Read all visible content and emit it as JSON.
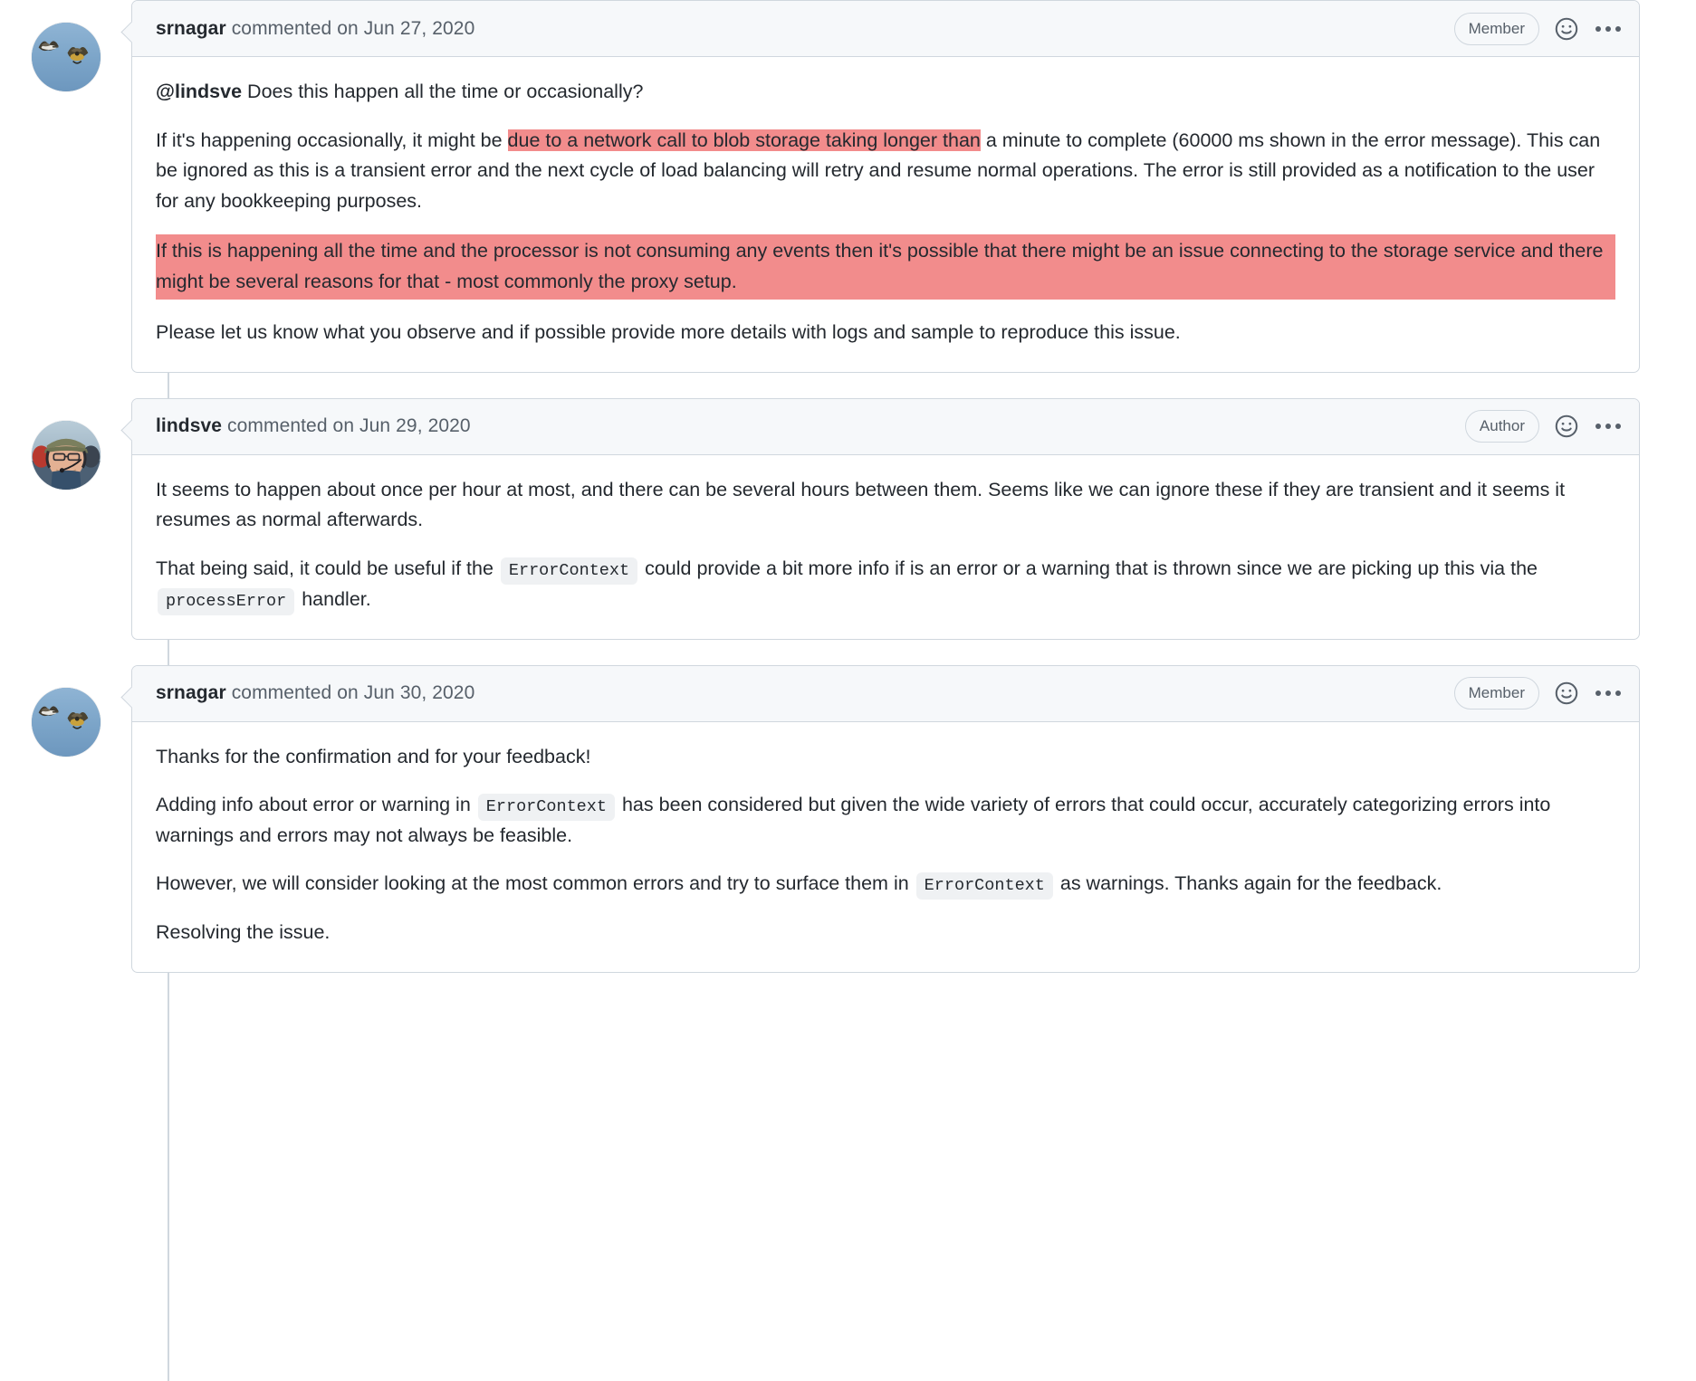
{
  "colors": {
    "highlight": "#f28c8c",
    "header_bg": "#f6f8fa",
    "border": "#d0d7de",
    "code_bg": "#eff1f3",
    "text": "#24292f",
    "muted_text": "#57606a"
  },
  "icons": {
    "reaction": "smiley-icon",
    "menu": "kebab-horizontal-icon"
  },
  "comments": [
    {
      "author": "srnagar",
      "meta": "commented on Jun 27, 2020",
      "badge": "Member",
      "avatar": "birds-flying-photo",
      "paragraphs": [
        {
          "id": "p1",
          "segments": [
            {
              "type": "mention",
              "text": "@lindsve"
            },
            {
              "type": "text",
              "text": " Does this happen all the time or occasionally?"
            }
          ]
        },
        {
          "id": "p2",
          "segments": [
            {
              "type": "text",
              "text": "If it's happening occasionally, it might be "
            },
            {
              "type": "highlight",
              "text": "due to a network call to blob storage taking longer than"
            },
            {
              "type": "text",
              "text": " a minute to complete (60000 ms shown in the error message). This can be ignored as this is a transient error and the next cycle of load balancing will retry and resume normal operations. The error is still provided as a notification to the user for any bookkeeping purposes."
            }
          ]
        },
        {
          "id": "p3",
          "block_highlight": true,
          "segments": [
            {
              "type": "text",
              "text": "If this is happening all the time and the processor is not consuming any events then it's possible that there might be an issue connecting to the storage service and there might be several reasons for that - most commonly the proxy setup."
            }
          ]
        },
        {
          "id": "p4",
          "segments": [
            {
              "type": "text",
              "text": "Please let us know what you observe and if possible provide more details with logs and sample to reproduce this issue."
            }
          ]
        }
      ]
    },
    {
      "author": "lindsve",
      "meta": "commented on Jun 29, 2020",
      "badge": "Author",
      "avatar": "pilot-headset-photo",
      "paragraphs": [
        {
          "id": "p1",
          "segments": [
            {
              "type": "text",
              "text": "It seems to happen about once per hour at most, and there can be several hours between them. Seems like we can ignore these if they are transient and it seems it resumes as normal afterwards."
            }
          ]
        },
        {
          "id": "p2",
          "segments": [
            {
              "type": "text",
              "text": "That being said, it could be useful if the "
            },
            {
              "type": "code",
              "text": "ErrorContext"
            },
            {
              "type": "text",
              "text": " could provide a bit more info if is an error or a warning that is thrown since we are picking up this via the "
            },
            {
              "type": "code",
              "text": "processError"
            },
            {
              "type": "text",
              "text": " handler."
            }
          ]
        }
      ]
    },
    {
      "author": "srnagar",
      "meta": "commented on Jun 30, 2020",
      "badge": "Member",
      "avatar": "birds-flying-photo",
      "paragraphs": [
        {
          "id": "p1",
          "segments": [
            {
              "type": "text",
              "text": "Thanks for the confirmation and for your feedback!"
            }
          ]
        },
        {
          "id": "p2",
          "segments": [
            {
              "type": "text",
              "text": "Adding info about error or warning in "
            },
            {
              "type": "code",
              "text": "ErrorContext"
            },
            {
              "type": "text",
              "text": " has been considered but given the wide variety of errors that could occur, accurately categorizing errors into warnings and errors may not always be feasible."
            }
          ]
        },
        {
          "id": "p3",
          "segments": [
            {
              "type": "text",
              "text": "However, we will consider looking at the most common errors and try to surface them in "
            },
            {
              "type": "code",
              "text": "ErrorContext"
            },
            {
              "type": "text",
              "text": " as warnings. Thanks again for the feedback."
            }
          ]
        },
        {
          "id": "p4",
          "segments": [
            {
              "type": "text",
              "text": "Resolving the issue."
            }
          ]
        }
      ]
    }
  ]
}
